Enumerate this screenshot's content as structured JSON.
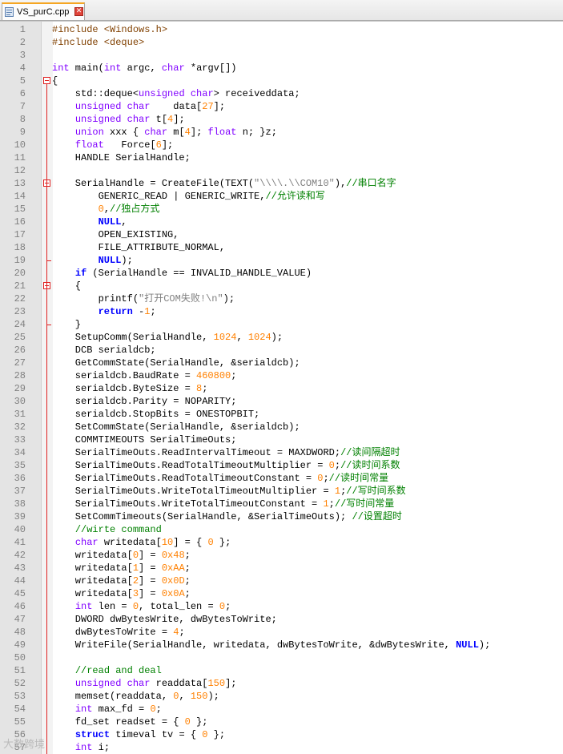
{
  "tab": {
    "icon": "cpp-file-icon",
    "title": "VS_purC.cpp",
    "close_icon": "close-icon",
    "close_glyph": "✕"
  },
  "colors": {
    "keyword": "#0000ff",
    "type": "#8000ff",
    "number": "#ff8000",
    "string": "#808080",
    "preprocessor": "#804000",
    "comment": "#008000",
    "fold_marker": "#e02020",
    "gutter_bg": "#e4e4e4"
  },
  "fold_markers": [
    {
      "line": 5,
      "icon": "fold-collapse-icon"
    },
    {
      "line": 13,
      "icon": "fold-collapse-icon"
    },
    {
      "line": 21,
      "icon": "fold-collapse-icon"
    }
  ],
  "lines": [
    {
      "n": "1",
      "segs": [
        {
          "t": "#include <Windows.h>",
          "c": "pp"
        }
      ]
    },
    {
      "n": "2",
      "segs": [
        {
          "t": "#include <deque>",
          "c": "pp"
        }
      ]
    },
    {
      "n": "3",
      "segs": []
    },
    {
      "n": "4",
      "segs": [
        {
          "t": "int",
          "c": "typ"
        },
        {
          "t": " main("
        },
        {
          "t": "int",
          "c": "typ"
        },
        {
          "t": " argc, "
        },
        {
          "t": "char",
          "c": "typ"
        },
        {
          "t": " *argv[])"
        }
      ]
    },
    {
      "n": "5",
      "segs": [
        {
          "t": "{"
        }
      ]
    },
    {
      "n": "6",
      "segs": [
        {
          "t": "    std::deque<"
        },
        {
          "t": "unsigned char",
          "c": "typ"
        },
        {
          "t": "> receiveddata;"
        }
      ]
    },
    {
      "n": "7",
      "segs": [
        {
          "t": "    "
        },
        {
          "t": "unsigned char",
          "c": "typ"
        },
        {
          "t": "    data["
        },
        {
          "t": "27",
          "c": "num"
        },
        {
          "t": "];"
        }
      ]
    },
    {
      "n": "8",
      "segs": [
        {
          "t": "    "
        },
        {
          "t": "unsigned char",
          "c": "typ"
        },
        {
          "t": " t["
        },
        {
          "t": "4",
          "c": "num"
        },
        {
          "t": "];"
        }
      ]
    },
    {
      "n": "9",
      "segs": [
        {
          "t": "    "
        },
        {
          "t": "union",
          "c": "typ"
        },
        {
          "t": " xxx { "
        },
        {
          "t": "char",
          "c": "typ"
        },
        {
          "t": " m["
        },
        {
          "t": "4",
          "c": "num"
        },
        {
          "t": "]; "
        },
        {
          "t": "float",
          "c": "typ"
        },
        {
          "t": " n; }z;"
        }
      ]
    },
    {
      "n": "10",
      "segs": [
        {
          "t": "    "
        },
        {
          "t": "float",
          "c": "typ"
        },
        {
          "t": "   Force["
        },
        {
          "t": "6",
          "c": "num"
        },
        {
          "t": "];"
        }
      ]
    },
    {
      "n": "11",
      "segs": [
        {
          "t": "    HANDLE SerialHandle;"
        }
      ]
    },
    {
      "n": "12",
      "segs": []
    },
    {
      "n": "13",
      "segs": [
        {
          "t": "    SerialHandle = CreateFile(TEXT("
        },
        {
          "t": "\"\\\\\\\\.\\\\COM10\"",
          "c": "str"
        },
        {
          "t": "),"
        },
        {
          "t": "//串口名字",
          "c": "cm"
        }
      ]
    },
    {
      "n": "14",
      "segs": [
        {
          "t": "        GENERIC_READ | GENERIC_WRITE,"
        },
        {
          "t": "//允许读和写",
          "c": "cm"
        }
      ]
    },
    {
      "n": "15",
      "segs": [
        {
          "t": "        "
        },
        {
          "t": "0",
          "c": "num"
        },
        {
          "t": ","
        },
        {
          "t": "//独占方式",
          "c": "cm"
        }
      ]
    },
    {
      "n": "16",
      "segs": [
        {
          "t": "        "
        },
        {
          "t": "NULL",
          "c": "kw",
          "b": true
        },
        {
          "t": ","
        }
      ]
    },
    {
      "n": "17",
      "segs": [
        {
          "t": "        OPEN_EXISTING,"
        }
      ]
    },
    {
      "n": "18",
      "segs": [
        {
          "t": "        FILE_ATTRIBUTE_NORMAL,"
        }
      ]
    },
    {
      "n": "19",
      "segs": [
        {
          "t": "        "
        },
        {
          "t": "NULL",
          "c": "kw",
          "b": true
        },
        {
          "t": ");"
        }
      ]
    },
    {
      "n": "20",
      "segs": [
        {
          "t": "    "
        },
        {
          "t": "if",
          "c": "kw",
          "b": true
        },
        {
          "t": " (SerialHandle == INVALID_HANDLE_VALUE)"
        }
      ]
    },
    {
      "n": "21",
      "segs": [
        {
          "t": "    {"
        }
      ]
    },
    {
      "n": "22",
      "segs": [
        {
          "t": "        printf("
        },
        {
          "t": "\"打开COM失败!\\n\"",
          "c": "str"
        },
        {
          "t": ");"
        }
      ]
    },
    {
      "n": "23",
      "segs": [
        {
          "t": "        "
        },
        {
          "t": "return",
          "c": "kw",
          "b": true
        },
        {
          "t": " -"
        },
        {
          "t": "1",
          "c": "num"
        },
        {
          "t": ";"
        }
      ]
    },
    {
      "n": "24",
      "segs": [
        {
          "t": "    }"
        }
      ]
    },
    {
      "n": "25",
      "segs": [
        {
          "t": "    SetupComm(SerialHandle, "
        },
        {
          "t": "1024",
          "c": "num"
        },
        {
          "t": ", "
        },
        {
          "t": "1024",
          "c": "num"
        },
        {
          "t": ");"
        }
      ]
    },
    {
      "n": "26",
      "segs": [
        {
          "t": "    DCB serialdcb;"
        }
      ]
    },
    {
      "n": "27",
      "segs": [
        {
          "t": "    GetCommState(SerialHandle, &serialdcb);"
        }
      ]
    },
    {
      "n": "28",
      "segs": [
        {
          "t": "    serialdcb.BaudRate = "
        },
        {
          "t": "460800",
          "c": "num"
        },
        {
          "t": ";"
        }
      ]
    },
    {
      "n": "29",
      "segs": [
        {
          "t": "    serialdcb.ByteSize = "
        },
        {
          "t": "8",
          "c": "num"
        },
        {
          "t": ";"
        }
      ]
    },
    {
      "n": "30",
      "segs": [
        {
          "t": "    serialdcb.Parity = NOPARITY;"
        }
      ]
    },
    {
      "n": "31",
      "segs": [
        {
          "t": "    serialdcb.StopBits = ONESTOPBIT;"
        }
      ]
    },
    {
      "n": "32",
      "segs": [
        {
          "t": "    SetCommState(SerialHandle, &serialdcb);"
        }
      ]
    },
    {
      "n": "33",
      "segs": [
        {
          "t": "    COMMTIMEOUTS SerialTimeOuts;"
        }
      ]
    },
    {
      "n": "34",
      "segs": [
        {
          "t": "    SerialTimeOuts.ReadIntervalTimeout = MAXDWORD;"
        },
        {
          "t": "//读间隔超时",
          "c": "cm"
        }
      ]
    },
    {
      "n": "35",
      "segs": [
        {
          "t": "    SerialTimeOuts.ReadTotalTimeoutMultiplier = "
        },
        {
          "t": "0",
          "c": "num"
        },
        {
          "t": ";"
        },
        {
          "t": "//读时间系数",
          "c": "cm"
        }
      ]
    },
    {
      "n": "36",
      "segs": [
        {
          "t": "    SerialTimeOuts.ReadTotalTimeoutConstant = "
        },
        {
          "t": "0",
          "c": "num"
        },
        {
          "t": ";"
        },
        {
          "t": "//读时间常量",
          "c": "cm"
        }
      ]
    },
    {
      "n": "37",
      "segs": [
        {
          "t": "    SerialTimeOuts.WriteTotalTimeoutMultiplier = "
        },
        {
          "t": "1",
          "c": "num"
        },
        {
          "t": ";"
        },
        {
          "t": "//写时间系数",
          "c": "cm"
        }
      ]
    },
    {
      "n": "38",
      "segs": [
        {
          "t": "    SerialTimeOuts.WriteTotalTimeoutConstant = "
        },
        {
          "t": "1",
          "c": "num"
        },
        {
          "t": ";"
        },
        {
          "t": "//写时间常量",
          "c": "cm"
        }
      ]
    },
    {
      "n": "39",
      "segs": [
        {
          "t": "    SetCommTimeouts(SerialHandle, &SerialTimeOuts); "
        },
        {
          "t": "//设置超时",
          "c": "cm"
        }
      ]
    },
    {
      "n": "40",
      "segs": [
        {
          "t": "    "
        },
        {
          "t": "//wirte command",
          "c": "cm"
        }
      ]
    },
    {
      "n": "41",
      "segs": [
        {
          "t": "    "
        },
        {
          "t": "char",
          "c": "typ"
        },
        {
          "t": " writedata["
        },
        {
          "t": "10",
          "c": "num"
        },
        {
          "t": "] = { "
        },
        {
          "t": "0",
          "c": "num"
        },
        {
          "t": " };"
        }
      ]
    },
    {
      "n": "42",
      "segs": [
        {
          "t": "    writedata["
        },
        {
          "t": "0",
          "c": "num"
        },
        {
          "t": "] = "
        },
        {
          "t": "0x48",
          "c": "num"
        },
        {
          "t": ";"
        }
      ]
    },
    {
      "n": "43",
      "segs": [
        {
          "t": "    writedata["
        },
        {
          "t": "1",
          "c": "num"
        },
        {
          "t": "] = "
        },
        {
          "t": "0xAA",
          "c": "num"
        },
        {
          "t": ";"
        }
      ]
    },
    {
      "n": "44",
      "segs": [
        {
          "t": "    writedata["
        },
        {
          "t": "2",
          "c": "num"
        },
        {
          "t": "] = "
        },
        {
          "t": "0x0D",
          "c": "num"
        },
        {
          "t": ";"
        }
      ]
    },
    {
      "n": "45",
      "segs": [
        {
          "t": "    writedata["
        },
        {
          "t": "3",
          "c": "num"
        },
        {
          "t": "] = "
        },
        {
          "t": "0x0A",
          "c": "num"
        },
        {
          "t": ";"
        }
      ]
    },
    {
      "n": "46",
      "segs": [
        {
          "t": "    "
        },
        {
          "t": "int",
          "c": "typ"
        },
        {
          "t": " len = "
        },
        {
          "t": "0",
          "c": "num"
        },
        {
          "t": ", total_len = "
        },
        {
          "t": "0",
          "c": "num"
        },
        {
          "t": ";"
        }
      ]
    },
    {
      "n": "47",
      "segs": [
        {
          "t": "    DWORD dwBytesWrite, dwBytesToWrite;"
        }
      ]
    },
    {
      "n": "48",
      "segs": [
        {
          "t": "    dwBytesToWrite = "
        },
        {
          "t": "4",
          "c": "num"
        },
        {
          "t": ";"
        }
      ]
    },
    {
      "n": "49",
      "segs": [
        {
          "t": "    WriteFile(SerialHandle, writedata, dwBytesToWrite, &dwBytesWrite, "
        },
        {
          "t": "NULL",
          "c": "kw",
          "b": true
        },
        {
          "t": ");"
        }
      ]
    },
    {
      "n": "50",
      "segs": []
    },
    {
      "n": "51",
      "segs": [
        {
          "t": "    "
        },
        {
          "t": "//read and deal",
          "c": "cm"
        }
      ]
    },
    {
      "n": "52",
      "segs": [
        {
          "t": "    "
        },
        {
          "t": "unsigned char",
          "c": "typ"
        },
        {
          "t": " readdata["
        },
        {
          "t": "150",
          "c": "num"
        },
        {
          "t": "];"
        }
      ]
    },
    {
      "n": "53",
      "segs": [
        {
          "t": "    memset(readdata, "
        },
        {
          "t": "0",
          "c": "num"
        },
        {
          "t": ", "
        },
        {
          "t": "150",
          "c": "num"
        },
        {
          "t": ");"
        }
      ]
    },
    {
      "n": "54",
      "segs": [
        {
          "t": "    "
        },
        {
          "t": "int",
          "c": "typ"
        },
        {
          "t": " max_fd = "
        },
        {
          "t": "0",
          "c": "num"
        },
        {
          "t": ";"
        }
      ]
    },
    {
      "n": "55",
      "segs": [
        {
          "t": "    fd_set readset = { "
        },
        {
          "t": "0",
          "c": "num"
        },
        {
          "t": " };"
        }
      ]
    },
    {
      "n": "56",
      "segs": [
        {
          "t": "    "
        },
        {
          "t": "struct",
          "c": "kw",
          "b": true
        },
        {
          "t": " timeval tv = { "
        },
        {
          "t": "0",
          "c": "num"
        },
        {
          "t": " };"
        }
      ]
    },
    {
      "n": "57",
      "segs": [
        {
          "t": "    "
        },
        {
          "t": "int",
          "c": "typ"
        },
        {
          "t": " i;"
        }
      ]
    }
  ],
  "watermark": "大数跨境"
}
